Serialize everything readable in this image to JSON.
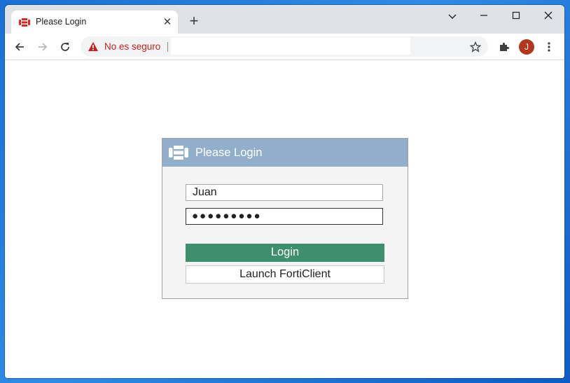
{
  "browser": {
    "tab_title": "Please Login",
    "tab_close": "✕",
    "new_tab": "+",
    "security_label": "No es seguro",
    "url": "",
    "avatar_letter": "J",
    "window_controls": {
      "chevron": "⌄",
      "minimize": "—",
      "maximize": "☐",
      "close": "✕"
    },
    "icons": {
      "favicon": "fortinet-logo-icon",
      "back": "back-arrow-icon",
      "forward": "forward-arrow-icon",
      "reload": "reload-icon",
      "warning": "warning-triangle-icon",
      "bookmark": "star-icon",
      "extensions": "puzzle-icon",
      "menu": "kebab-menu-icon"
    }
  },
  "login": {
    "header_title": "Please Login",
    "username_value": "Juan",
    "password_value": "●●●●●●●●●",
    "login_button": "Login",
    "forticlient_button": "Launch FortiClient"
  },
  "colors": {
    "header_bg": "#91afca",
    "login_button_bg": "#3d8f6e",
    "not_secure_red": "#c5221f",
    "avatar_bg": "#b3361f"
  }
}
